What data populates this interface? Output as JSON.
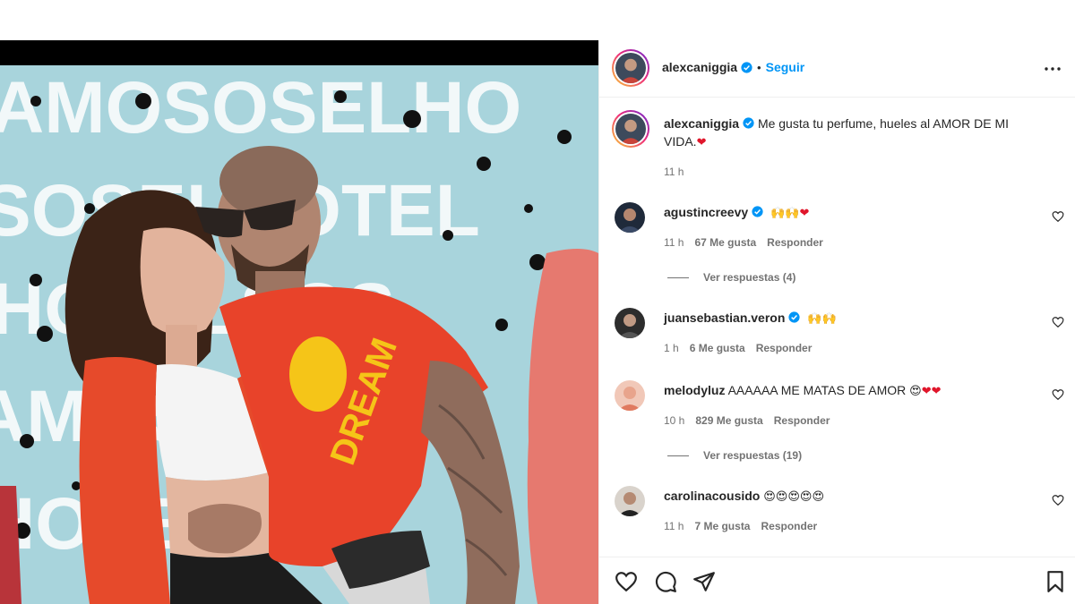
{
  "post": {
    "author": "alexcaniggia",
    "dot": "•",
    "follow_label": "Seguir",
    "more_icon": "more-options-icon"
  },
  "caption": {
    "username": "alexcaniggia",
    "text": "Me gusta tu perfume, hueles al AMOR DE MI VIDA.",
    "emoji": "❤",
    "time": "11 h"
  },
  "comments": [
    {
      "username": "agustincreevy",
      "verified": true,
      "text": "",
      "emoji": "🙌🙌❤",
      "time": "11 h",
      "likes": "67 Me gusta",
      "reply": "Responder",
      "view_replies": "Ver respuestas (4)"
    },
    {
      "username": "juansebastian.veron",
      "verified": true,
      "text": "",
      "emoji": "🙌🙌",
      "time": "1 h",
      "likes": "6 Me gusta",
      "reply": "Responder",
      "view_replies": ""
    },
    {
      "username": "melodyluz",
      "verified": false,
      "text": "AAAAAA ME MATAS DE AMOR",
      "emoji": "😍❤❤",
      "time": "10 h",
      "likes": "829 Me gusta",
      "reply": "Responder",
      "view_replies": "Ver respuestas (19)"
    },
    {
      "username": "carolinacousido",
      "verified": false,
      "text": "",
      "emoji": "😍😍😍😍😍",
      "time": "11 h",
      "likes": "7 Me gusta",
      "reply": "Responder",
      "view_replies": ""
    }
  ],
  "colors": {
    "accent": "#0095f6",
    "muted": "#737373",
    "heart": "#e0162b",
    "shirt": "#e8432a",
    "banner": "#a8d4dc"
  }
}
